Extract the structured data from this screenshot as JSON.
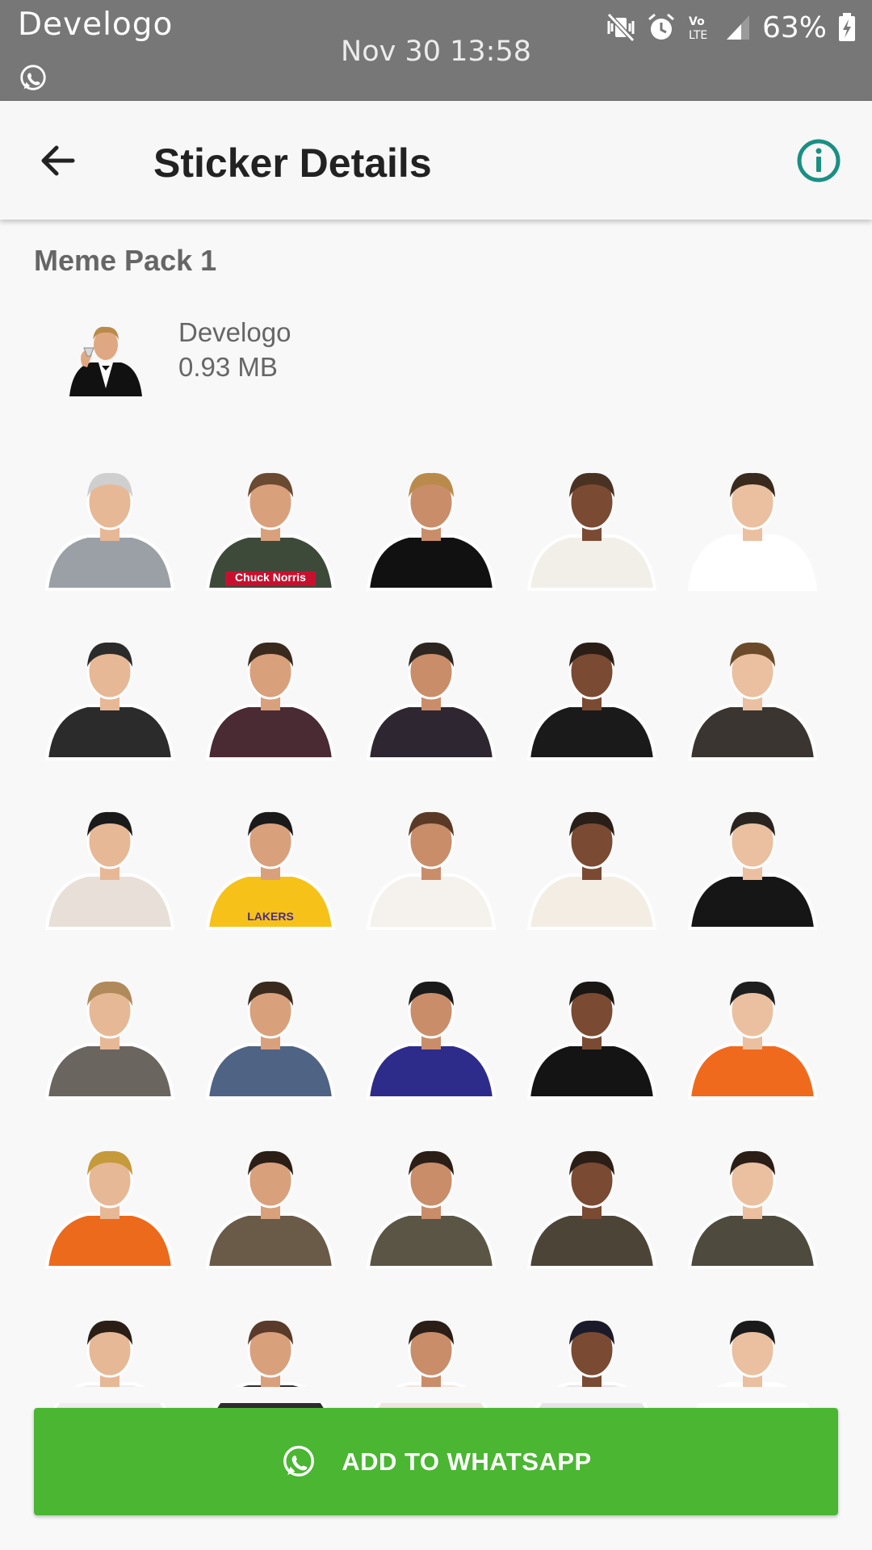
{
  "status_bar": {
    "notification_title": "Develogo",
    "clock": "Nov 30 13:58",
    "battery": "63%",
    "icons": [
      "whatsapp-icon",
      "mute-vibrate-icon",
      "alarm-icon",
      "volte-icon",
      "signal-icon",
      "battery-charging-icon"
    ]
  },
  "app_bar": {
    "title": "Sticker Details",
    "back_icon": "arrow-back-icon",
    "info_icon": "info-icon"
  },
  "pack": {
    "name": "Meme Pack 1",
    "publisher": "Develogo",
    "size": "0.93 MB"
  },
  "stickers": [
    {
      "name": "lemur",
      "label": ""
    },
    {
      "name": "chuck-norris-thumbs-up",
      "label": "Chuck Norris"
    },
    {
      "name": "leo-toast",
      "label": ""
    },
    {
      "name": "leo-pointing",
      "label": ""
    },
    {
      "name": "leo-sunglasses",
      "label": ""
    },
    {
      "name": "man-laughing",
      "label": ""
    },
    {
      "name": "rdj-arms-crossed",
      "label": ""
    },
    {
      "name": "rdj-eye-roll",
      "label": ""
    },
    {
      "name": "woman-smiling",
      "label": ""
    },
    {
      "name": "tom-laughing",
      "label": ""
    },
    {
      "name": "yao-ming-laugh",
      "label": ""
    },
    {
      "name": "kobe-shrug",
      "label": "LAKERS"
    },
    {
      "name": "woman-shrug",
      "label": ""
    },
    {
      "name": "woman-clapping",
      "label": ""
    },
    {
      "name": "man-in-suit",
      "label": ""
    },
    {
      "name": "ryan-gesture",
      "label": ""
    },
    {
      "name": "colin-shrug",
      "label": ""
    },
    {
      "name": "girl-side-eye",
      "label": ""
    },
    {
      "name": "tobey-smirk",
      "label": ""
    },
    {
      "name": "drake-yes",
      "label": ""
    },
    {
      "name": "drake-no",
      "label": ""
    },
    {
      "name": "mr-bean-wave",
      "label": ""
    },
    {
      "name": "mr-bean-standing",
      "label": ""
    },
    {
      "name": "mr-bean-pose",
      "label": ""
    },
    {
      "name": "mr-bean-shocked",
      "label": ""
    },
    {
      "name": "mr-bean-drink",
      "label": ""
    },
    {
      "name": "man-surprised",
      "label": ""
    },
    {
      "name": "jim-carrey-face",
      "label": ""
    },
    {
      "name": "jim-carrey-shocked",
      "label": ""
    },
    {
      "name": "man-typing",
      "label": ""
    }
  ],
  "add_button": {
    "label": "ADD TO WHATSAPP",
    "icon": "whatsapp-icon"
  },
  "colors": {
    "status_bar": "#777777",
    "accent_teal": "#1a8f83",
    "button_green": "#4ab632",
    "text_gray": "#666666"
  }
}
